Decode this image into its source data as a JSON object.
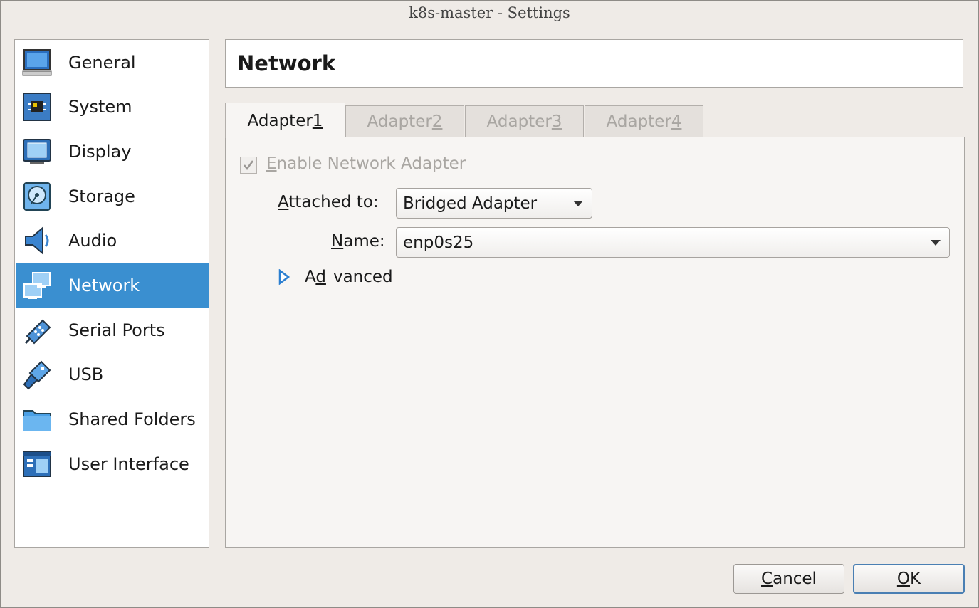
{
  "window": {
    "title": "k8s-master - Settings"
  },
  "sidebar": {
    "items": [
      {
        "label": "General",
        "icon": "monitor-icon"
      },
      {
        "label": "System",
        "icon": "chip-icon"
      },
      {
        "label": "Display",
        "icon": "display-icon"
      },
      {
        "label": "Storage",
        "icon": "disk-icon"
      },
      {
        "label": "Audio",
        "icon": "speaker-icon"
      },
      {
        "label": "Network",
        "icon": "network-icon",
        "selected": true
      },
      {
        "label": "Serial Ports",
        "icon": "serial-port-icon"
      },
      {
        "label": "USB",
        "icon": "usb-icon"
      },
      {
        "label": "Shared Folders",
        "icon": "folder-icon"
      },
      {
        "label": "User Interface",
        "icon": "window-icon"
      }
    ]
  },
  "header": {
    "title": "Network"
  },
  "tabs": {
    "adapter1": {
      "text": "Adapter ",
      "key": "1"
    },
    "adapter2": {
      "text": "Adapter ",
      "key": "2"
    },
    "adapter3": {
      "text": "Adapter ",
      "key": "3"
    },
    "adapter4": {
      "text": "Adapter ",
      "key": "4"
    }
  },
  "adapter": {
    "enable_label": {
      "key": "E",
      "rest": "nable Network Adapter"
    },
    "enabled": true,
    "attached_label": {
      "key": "A",
      "rest": "ttached to:"
    },
    "attached_value": "Bridged Adapter",
    "name_label": {
      "key": "N",
      "rest": "ame:"
    },
    "name_value": "enp0s25",
    "advanced_label": {
      "pre": "A",
      "key": "d",
      "rest": "vanced"
    }
  },
  "buttons": {
    "cancel": {
      "key": "C",
      "rest": "ancel"
    },
    "ok": {
      "key": "O",
      "rest": "K"
    }
  },
  "colors": {
    "selection": "#3a8fd0",
    "default_button_border": "#4a7fb3"
  }
}
